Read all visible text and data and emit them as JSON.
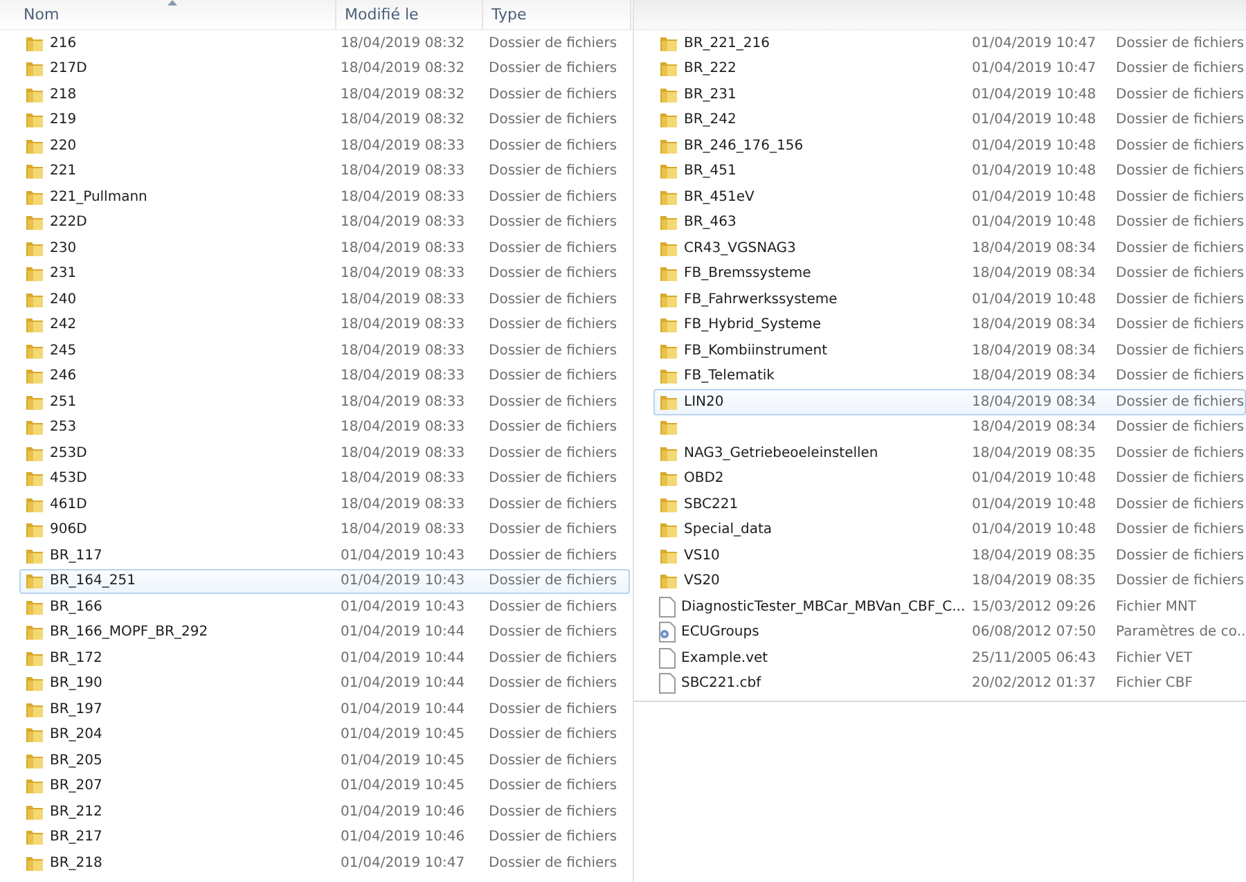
{
  "left_pane": {
    "columns": [
      {
        "label": "Nom",
        "sorted": true
      },
      {
        "label": "Modifié le",
        "sorted": false
      },
      {
        "label": "Type",
        "sorted": false
      }
    ],
    "rows": [
      {
        "kind": "folder",
        "name": "216",
        "modified": "18/04/2019 08:32",
        "type": "Dossier de fichiers",
        "selected": false
      },
      {
        "kind": "folder",
        "name": "217D",
        "modified": "18/04/2019 08:32",
        "type": "Dossier de fichiers",
        "selected": false
      },
      {
        "kind": "folder",
        "name": "218",
        "modified": "18/04/2019 08:32",
        "type": "Dossier de fichiers",
        "selected": false
      },
      {
        "kind": "folder",
        "name": "219",
        "modified": "18/04/2019 08:32",
        "type": "Dossier de fichiers",
        "selected": false
      },
      {
        "kind": "folder",
        "name": "220",
        "modified": "18/04/2019 08:33",
        "type": "Dossier de fichiers",
        "selected": false
      },
      {
        "kind": "folder",
        "name": "221",
        "modified": "18/04/2019 08:33",
        "type": "Dossier de fichiers",
        "selected": false
      },
      {
        "kind": "folder",
        "name": "221_Pullmann",
        "modified": "18/04/2019 08:33",
        "type": "Dossier de fichiers",
        "selected": false
      },
      {
        "kind": "folder",
        "name": "222D",
        "modified": "18/04/2019 08:33",
        "type": "Dossier de fichiers",
        "selected": false
      },
      {
        "kind": "folder",
        "name": "230",
        "modified": "18/04/2019 08:33",
        "type": "Dossier de fichiers",
        "selected": false
      },
      {
        "kind": "folder",
        "name": "231",
        "modified": "18/04/2019 08:33",
        "type": "Dossier de fichiers",
        "selected": false
      },
      {
        "kind": "folder",
        "name": "240",
        "modified": "18/04/2019 08:33",
        "type": "Dossier de fichiers",
        "selected": false
      },
      {
        "kind": "folder",
        "name": "242",
        "modified": "18/04/2019 08:33",
        "type": "Dossier de fichiers",
        "selected": false
      },
      {
        "kind": "folder",
        "name": "245",
        "modified": "18/04/2019 08:33",
        "type": "Dossier de fichiers",
        "selected": false
      },
      {
        "kind": "folder",
        "name": "246",
        "modified": "18/04/2019 08:33",
        "type": "Dossier de fichiers",
        "selected": false
      },
      {
        "kind": "folder",
        "name": "251",
        "modified": "18/04/2019 08:33",
        "type": "Dossier de fichiers",
        "selected": false
      },
      {
        "kind": "folder",
        "name": "253",
        "modified": "18/04/2019 08:33",
        "type": "Dossier de fichiers",
        "selected": false
      },
      {
        "kind": "folder",
        "name": "253D",
        "modified": "18/04/2019 08:33",
        "type": "Dossier de fichiers",
        "selected": false
      },
      {
        "kind": "folder",
        "name": "453D",
        "modified": "18/04/2019 08:33",
        "type": "Dossier de fichiers",
        "selected": false
      },
      {
        "kind": "folder",
        "name": "461D",
        "modified": "18/04/2019 08:33",
        "type": "Dossier de fichiers",
        "selected": false
      },
      {
        "kind": "folder",
        "name": "906D",
        "modified": "18/04/2019 08:33",
        "type": "Dossier de fichiers",
        "selected": false
      },
      {
        "kind": "folder",
        "name": "BR_117",
        "modified": "01/04/2019 10:43",
        "type": "Dossier de fichiers",
        "selected": false
      },
      {
        "kind": "folder",
        "name": "BR_164_251",
        "modified": "01/04/2019 10:43",
        "type": "Dossier de fichiers",
        "selected": true
      },
      {
        "kind": "folder",
        "name": "BR_166",
        "modified": "01/04/2019 10:43",
        "type": "Dossier de fichiers",
        "selected": false
      },
      {
        "kind": "folder",
        "name": "BR_166_MOPF_BR_292",
        "modified": "01/04/2019 10:44",
        "type": "Dossier de fichiers",
        "selected": false
      },
      {
        "kind": "folder",
        "name": "BR_172",
        "modified": "01/04/2019 10:44",
        "type": "Dossier de fichiers",
        "selected": false
      },
      {
        "kind": "folder",
        "name": "BR_190",
        "modified": "01/04/2019 10:44",
        "type": "Dossier de fichiers",
        "selected": false
      },
      {
        "kind": "folder",
        "name": "BR_197",
        "modified": "01/04/2019 10:44",
        "type": "Dossier de fichiers",
        "selected": false
      },
      {
        "kind": "folder",
        "name": "BR_204",
        "modified": "01/04/2019 10:45",
        "type": "Dossier de fichiers",
        "selected": false
      },
      {
        "kind": "folder",
        "name": "BR_205",
        "modified": "01/04/2019 10:45",
        "type": "Dossier de fichiers",
        "selected": false
      },
      {
        "kind": "folder",
        "name": "BR_207",
        "modified": "01/04/2019 10:45",
        "type": "Dossier de fichiers",
        "selected": false
      },
      {
        "kind": "folder",
        "name": "BR_212",
        "modified": "01/04/2019 10:46",
        "type": "Dossier de fichiers",
        "selected": false
      },
      {
        "kind": "folder",
        "name": "BR_217",
        "modified": "01/04/2019 10:46",
        "type": "Dossier de fichiers",
        "selected": false
      },
      {
        "kind": "folder",
        "name": "BR_218",
        "modified": "01/04/2019 10:47",
        "type": "Dossier de fichiers",
        "selected": false
      }
    ]
  },
  "right_pane": {
    "rows": [
      {
        "kind": "folder",
        "name": "BR_221_216",
        "modified": "01/04/2019 10:47",
        "type": "Dossier de fichiers",
        "selected": false
      },
      {
        "kind": "folder",
        "name": "BR_222",
        "modified": "01/04/2019 10:47",
        "type": "Dossier de fichiers",
        "selected": false
      },
      {
        "kind": "folder",
        "name": "BR_231",
        "modified": "01/04/2019 10:48",
        "type": "Dossier de fichiers",
        "selected": false
      },
      {
        "kind": "folder",
        "name": "BR_242",
        "modified": "01/04/2019 10:48",
        "type": "Dossier de fichiers",
        "selected": false
      },
      {
        "kind": "folder",
        "name": "BR_246_176_156",
        "modified": "01/04/2019 10:48",
        "type": "Dossier de fichiers",
        "selected": false
      },
      {
        "kind": "folder",
        "name": "BR_451",
        "modified": "01/04/2019 10:48",
        "type": "Dossier de fichiers",
        "selected": false
      },
      {
        "kind": "folder",
        "name": "BR_451eV",
        "modified": "01/04/2019 10:48",
        "type": "Dossier de fichiers",
        "selected": false
      },
      {
        "kind": "folder",
        "name": "BR_463",
        "modified": "01/04/2019 10:48",
        "type": "Dossier de fichiers",
        "selected": false
      },
      {
        "kind": "folder",
        "name": "CR43_VGSNAG3",
        "modified": "18/04/2019 08:34",
        "type": "Dossier de fichiers",
        "selected": false
      },
      {
        "kind": "folder",
        "name": "FB_Bremssysteme",
        "modified": "18/04/2019 08:34",
        "type": "Dossier de fichiers",
        "selected": false
      },
      {
        "kind": "folder",
        "name": "FB_Fahrwerkssysteme",
        "modified": "01/04/2019 10:48",
        "type": "Dossier de fichiers",
        "selected": false
      },
      {
        "kind": "folder",
        "name": "FB_Hybrid_Systeme",
        "modified": "18/04/2019 08:34",
        "type": "Dossier de fichiers",
        "selected": false
      },
      {
        "kind": "folder",
        "name": "FB_Kombiinstrument",
        "modified": "18/04/2019 08:34",
        "type": "Dossier de fichiers",
        "selected": false
      },
      {
        "kind": "folder",
        "name": "FB_Telematik",
        "modified": "18/04/2019 08:34",
        "type": "Dossier de fichiers",
        "selected": false
      },
      {
        "kind": "folder",
        "name": "LIN20",
        "modified": "18/04/2019 08:34",
        "type": "Dossier de fichiers",
        "selected": true
      },
      {
        "kind": "folder",
        "modified": "18/04/2019 08:34",
        "type": "Dossier de fichiers",
        "selected": false
      },
      {
        "kind": "folder",
        "name": "NAG3_Getriebeoeleinstellen",
        "modified": "18/04/2019 08:35",
        "type": "Dossier de fichiers",
        "selected": false
      },
      {
        "kind": "folder",
        "name": "OBD2",
        "modified": "01/04/2019 10:48",
        "type": "Dossier de fichiers",
        "selected": false
      },
      {
        "kind": "folder",
        "name": "SBC221",
        "modified": "01/04/2019 10:48",
        "type": "Dossier de fichiers",
        "selected": false
      },
      {
        "kind": "folder",
        "name": "Special_data",
        "modified": "01/04/2019 10:48",
        "type": "Dossier de fichiers",
        "selected": false
      },
      {
        "kind": "folder",
        "name": "VS10",
        "modified": "18/04/2019 08:35",
        "type": "Dossier de fichiers",
        "selected": false
      },
      {
        "kind": "folder",
        "name": "VS20",
        "modified": "18/04/2019 08:35",
        "type": "Dossier de fichiers",
        "selected": false
      },
      {
        "kind": "file",
        "name": "DiagnosticTester_MBCar_MBVan_CBF_C...",
        "modified": "15/03/2012 09:26",
        "type": "Fichier MNT",
        "selected": false
      },
      {
        "kind": "settings",
        "name": "ECUGroups",
        "modified": "06/08/2012 07:50",
        "type": "Paramètres de co...",
        "selected": false
      },
      {
        "kind": "file",
        "name": "Example.vet",
        "modified": "25/11/2005 06:43",
        "type": "Fichier VET",
        "selected": false
      },
      {
        "kind": "file",
        "name": "SBC221.cbf",
        "modified": "20/02/2012 01:37",
        "type": "Fichier CBF",
        "selected": false
      }
    ]
  }
}
